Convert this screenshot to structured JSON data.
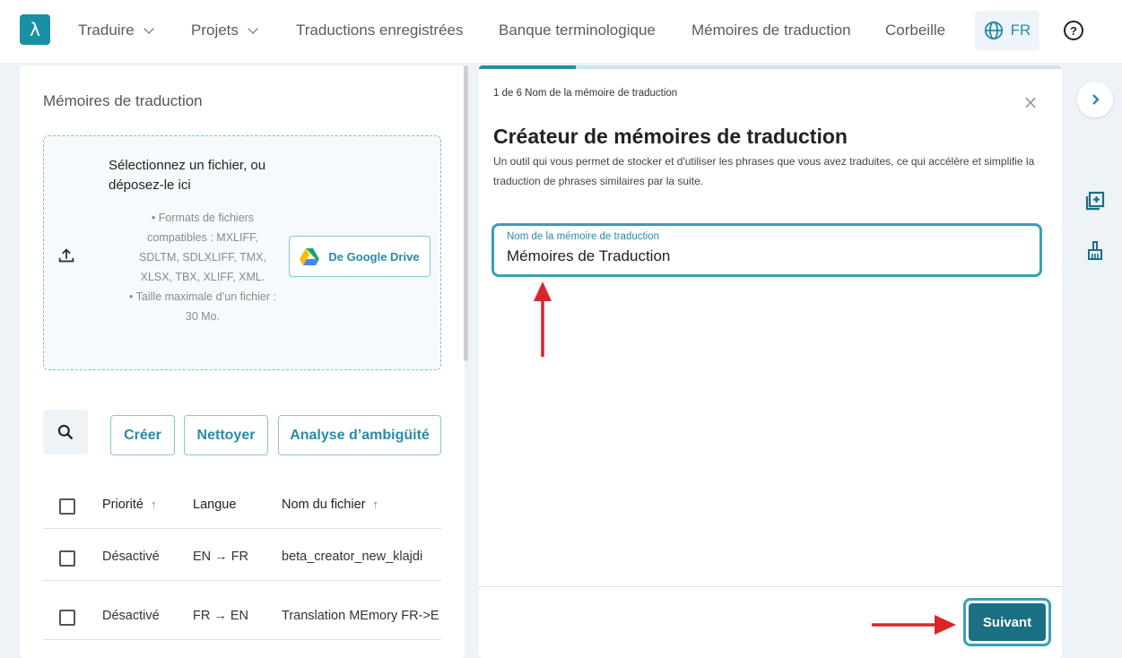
{
  "nav": {
    "items": [
      {
        "label": "Traduire",
        "dropdown": true
      },
      {
        "label": "Projets",
        "dropdown": true
      },
      {
        "label": "Traductions enregistrées",
        "dropdown": false
      },
      {
        "label": "Banque terminologique",
        "dropdown": false
      },
      {
        "label": "Mémoires de traduction",
        "dropdown": false
      },
      {
        "label": "Corbeille",
        "dropdown": false
      }
    ],
    "language": "FR",
    "logo": "λ",
    "help_symbol": "?"
  },
  "left_panel": {
    "title": "Mémoires de traduction",
    "dropzone": {
      "title": "Sélectionnez un fichier, ou déposez-le ici",
      "info": [
        "Formats de fichiers compatibles : MXLIFF, SDLTM, SDLXLIFF, TMX, XLSX, TBX, XLIFF, XML.",
        "Taille maximale d’un fichier : 30 Mo."
      ],
      "google_drive_label": "De Google Drive"
    },
    "actions": {
      "create": "Créer",
      "clean": "Nettoyer",
      "ambiguity": "Analyse d’ambigüité"
    },
    "table": {
      "headers": {
        "priority": "Priorité",
        "language": "Langue",
        "filename": "Nom du fichier"
      },
      "sort_arrow": "↑",
      "rows": [
        {
          "priority": "Désactivé",
          "language": "EN → FR",
          "filename": "beta_creator_new_klajdi"
        },
        {
          "priority": "Désactivé",
          "language": "FR → EN",
          "filename": "Translation MEmory FR->E"
        }
      ]
    }
  },
  "wizard": {
    "step_label": "1 de 6 Nom de la mémoire de traduction",
    "progress_fraction": 0.1667,
    "close_symbol": "×",
    "title": "Créateur de mémoires de traduction",
    "description": "Un outil qui vous permet de stocker et d'utiliser les phrases que vous avez traduites, ce qui accélère et simplifie la traduction de phrases similaires par la suite.",
    "field_label": "Nom de la mémoire de traduction",
    "field_value": "Mémoires de Traduction",
    "next_label": "Suivant"
  },
  "colors": {
    "accent": "#2a8aa8",
    "primary_dark": "#1b6f83",
    "background": "#eef3f8",
    "annotation_arrow": "#d9262b"
  },
  "icons": {
    "upload": "upload-icon",
    "google_drive": "google-drive-icon",
    "search": "search-icon",
    "globe": "globe-icon",
    "help": "help-circle-icon",
    "close": "close-icon",
    "rail_toggle": "chevron-right-icon",
    "rail_add": "add-box-icon",
    "rail_clean": "broom-icon"
  }
}
